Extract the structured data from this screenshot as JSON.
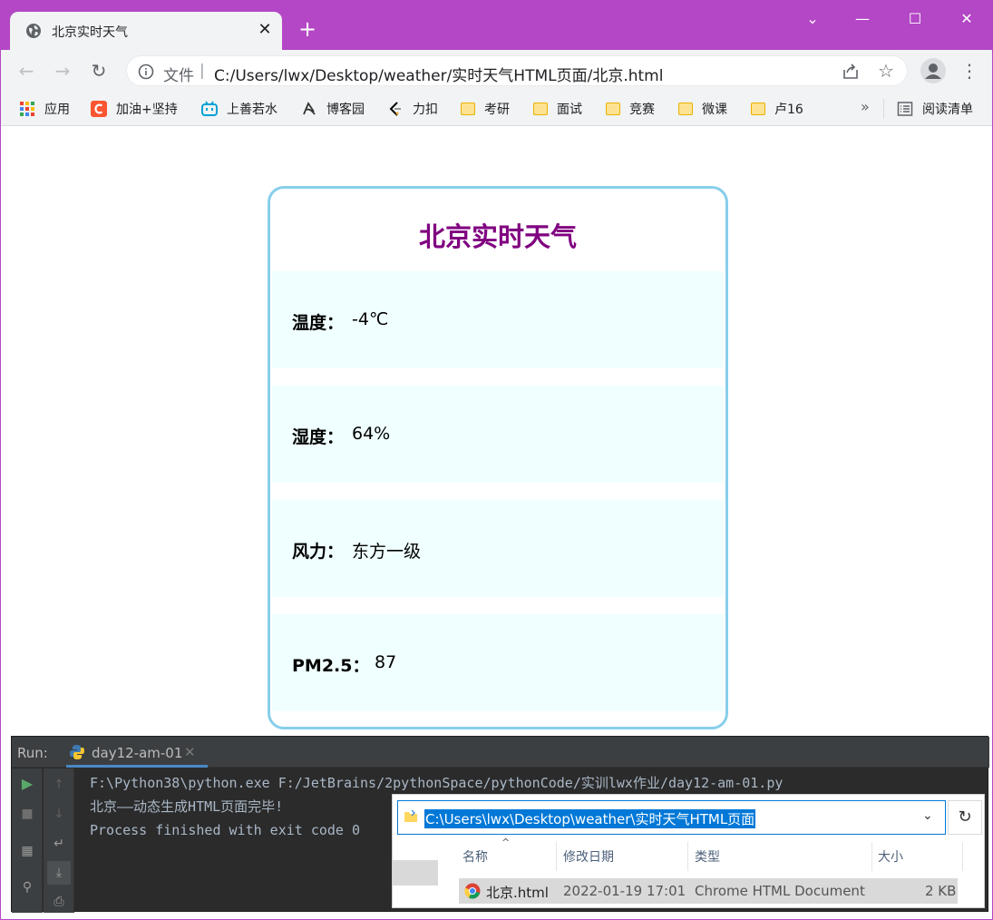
{
  "colors": {
    "titlebar": "#b347c5",
    "card_border": "#87ceeb",
    "card_title": "#800080",
    "row_background": "#f0ffff",
    "console_bg": "#2b2b2b",
    "selection": "#0078d7"
  },
  "browser": {
    "tab_title": "北京实时天气",
    "tab_close": "✕",
    "new_tab": "+",
    "window_controls": [
      "⌄",
      "—",
      "☐",
      "✕"
    ],
    "nav": {
      "back": "←",
      "forward": "→",
      "reload": "↻"
    },
    "omnibox": {
      "scheme_label": "文件",
      "separator": "|",
      "url": "C:/Users/lwx/Desktop/weather/实时天气HTML页面/北京.html"
    },
    "star": "☆",
    "menu": "⋮"
  },
  "bookmarks": {
    "items": [
      {
        "label": "应用",
        "icon": "apps-grid-icon"
      },
      {
        "label": "加油+坚持",
        "icon": "csdn-icon"
      },
      {
        "label": "上善若水",
        "icon": "bilibili-icon"
      },
      {
        "label": "博客园",
        "icon": "cnblogs-icon"
      },
      {
        "label": "力扣",
        "icon": "leetcode-icon"
      },
      {
        "label": "考研",
        "icon": "folder-icon"
      },
      {
        "label": "面试",
        "icon": "folder-icon"
      },
      {
        "label": "竞赛",
        "icon": "folder-icon"
      },
      {
        "label": "微课",
        "icon": "folder-icon"
      },
      {
        "label": "卢16",
        "icon": "folder-icon"
      }
    ],
    "more": "»",
    "reading_list": "阅读清单"
  },
  "weather": {
    "title": "北京实时天气",
    "rows": [
      {
        "label": "温度：",
        "value": "-4℃"
      },
      {
        "label": "湿度：",
        "value": "64%"
      },
      {
        "label": "风力：",
        "value": "东方一级"
      },
      {
        "label": "PM2.5：",
        "value": "87"
      }
    ]
  },
  "run_panel": {
    "label": "Run:",
    "tab_label": "day12-am-01",
    "tab_close": "✕",
    "console_lines": [
      "F:\\Python38\\python.exe F:/JetBrains/2pythonSpace/pythonCode/实训lwx作业/day12-am-01.py",
      "北京——动态生成HTML页面完毕!",
      "",
      "Process finished with exit code 0"
    ]
  },
  "explorer": {
    "path": "C:\\Users\\lwx\\Desktop\\weather\\实时天气HTML页面",
    "chevron": "⌄",
    "refresh": "↻",
    "sort_arrow": "^",
    "columns": [
      "名称",
      "修改日期",
      "类型",
      "大小"
    ],
    "file": {
      "name": "北京.html",
      "modified": "2022-01-19 17:01",
      "type": "Chrome HTML Document",
      "size": "2 KB"
    }
  }
}
